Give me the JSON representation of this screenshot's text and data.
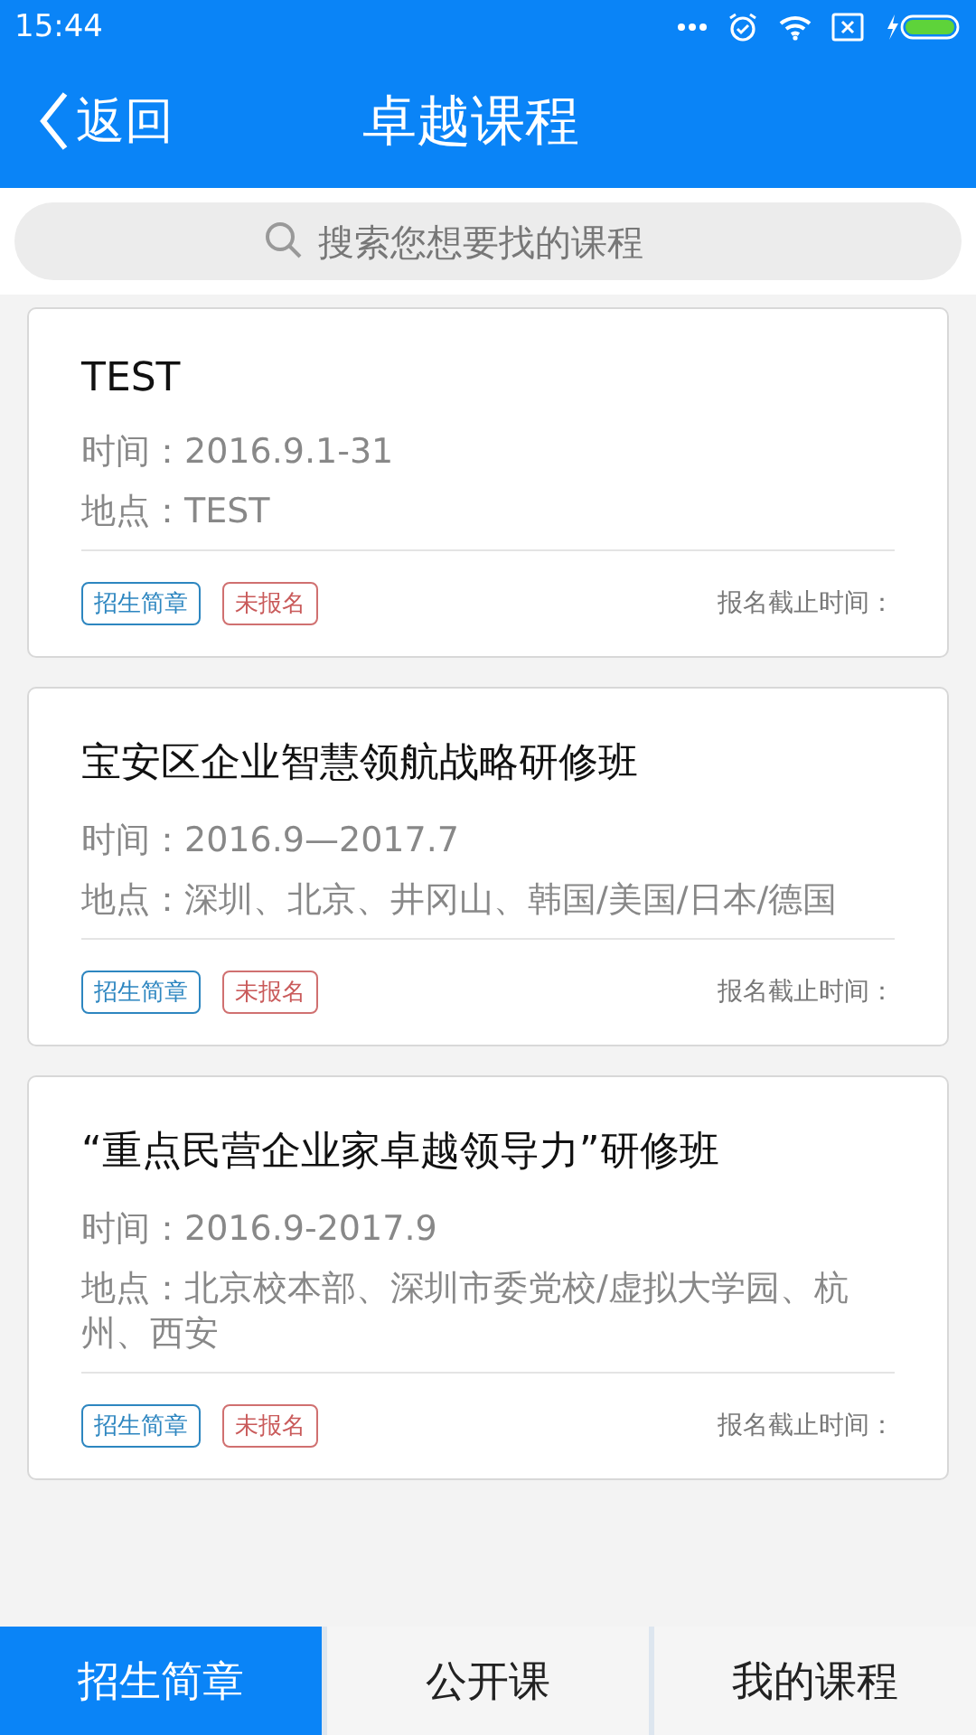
{
  "status_bar": {
    "time": "15:44"
  },
  "header": {
    "back": "返回",
    "title": "卓越课程"
  },
  "search": {
    "placeholder": "搜索您想要找的课程"
  },
  "courses": [
    {
      "title": "TEST",
      "time": "时间：2016.9.1-31",
      "place": "地点：TEST",
      "tags": [
        {
          "label": "招生简章",
          "kind": "brochure"
        },
        {
          "label": "未报名",
          "kind": "unregistered"
        }
      ],
      "deadline": "报名截止时间："
    },
    {
      "title": "宝安区企业智慧领航战略研修班",
      "time": "时间：2016.9—2017.7",
      "place": "地点：深圳、北京、井冈山、韩国/美国/日本/德国",
      "tags": [
        {
          "label": "招生简章",
          "kind": "brochure"
        },
        {
          "label": "未报名",
          "kind": "unregistered"
        }
      ],
      "deadline": "报名截止时间："
    },
    {
      "title": "“重点民营企业家卓越领导力”研修班",
      "time": "时间：2016.9-2017.9",
      "place": "地点：北京校本部、深圳市委党校/虚拟大学园、杭州、西安",
      "tags": [
        {
          "label": "招生简章",
          "kind": "brochure"
        },
        {
          "label": "未报名",
          "kind": "unregistered"
        }
      ],
      "deadline": "报名截止时间："
    }
  ],
  "tabs": [
    {
      "label": "招生简章",
      "selected": true
    },
    {
      "label": "公开课",
      "selected": false
    },
    {
      "label": "我的课程",
      "selected": false
    }
  ]
}
